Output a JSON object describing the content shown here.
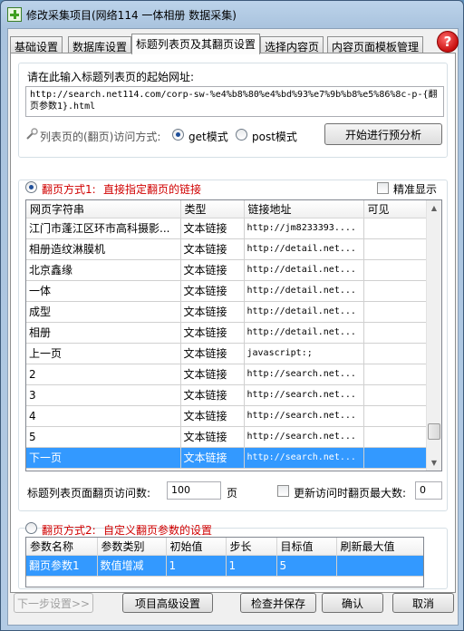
{
  "window": {
    "title": "修改采集项目(网络114 一体相册 数据采集)"
  },
  "tabs": [
    {
      "label": "基础设置",
      "active": false
    },
    {
      "label": "数据库设置",
      "active": false
    },
    {
      "label": "标题列表页及其翻页设置",
      "active": true
    },
    {
      "label": "选择内容页",
      "active": false
    },
    {
      "label": "内容页面模板管理",
      "active": false
    }
  ],
  "help_icon": "help-icon",
  "start_url": {
    "label": "请在此输入标题列表页的起始网址:",
    "value": "http://search.net114.com/corp-sw-%e4%b8%80%e4%bd%93%e7%9b%b8%e5%86%8c-p-{翻页参数1}.html"
  },
  "access_mode": {
    "label": "列表页的(翻页)访问方式:",
    "options": [
      {
        "label": "get模式",
        "selected": true
      },
      {
        "label": "post模式",
        "selected": false
      }
    ],
    "preview_button": "开始进行预分析"
  },
  "mode1": {
    "radio_label": "翻页方式1:",
    "desc": "直接指定翻页的链接",
    "exact_display": "精准显示",
    "columns": [
      "网页字符串",
      "类型",
      "链接地址",
      "可见"
    ],
    "rows": [
      {
        "text": "江门市蓬江区环市高科摄影...",
        "type": "文本链接",
        "url": "http://jm8233393....",
        "visible": "",
        "selected": false
      },
      {
        "text": "相册造纹淋膜机",
        "type": "文本链接",
        "url": "http://detail.net...",
        "visible": "",
        "selected": false
      },
      {
        "text": "北京鑫缘",
        "type": "文本链接",
        "url": "http://detail.net...",
        "visible": "",
        "selected": false
      },
      {
        "text": "一体",
        "type": "文本链接",
        "url": "http://detail.net...",
        "visible": "",
        "selected": false
      },
      {
        "text": "成型",
        "type": "文本链接",
        "url": "http://detail.net...",
        "visible": "",
        "selected": false
      },
      {
        "text": "相册",
        "type": "文本链接",
        "url": "http://detail.net...",
        "visible": "",
        "selected": false
      },
      {
        "text": "上一页",
        "type": "文本链接",
        "url": "javascript:;",
        "visible": "",
        "selected": false
      },
      {
        "text": "2",
        "type": "文本链接",
        "url": "http://search.net...",
        "visible": "",
        "selected": false
      },
      {
        "text": "3",
        "type": "文本链接",
        "url": "http://search.net...",
        "visible": "",
        "selected": false
      },
      {
        "text": "4",
        "type": "文本链接",
        "url": "http://search.net...",
        "visible": "",
        "selected": false
      },
      {
        "text": "5",
        "type": "文本链接",
        "url": "http://search.net...",
        "visible": "",
        "selected": false
      },
      {
        "text": "下一页",
        "type": "文本链接",
        "url": "http://search.net...",
        "visible": "",
        "selected": true
      }
    ],
    "scroll_position": 0.93,
    "max_pages_label": "标题列表页面翻页访问数:",
    "max_pages_value": "100",
    "max_pages_unit": "页",
    "refresh_label": "更新访问时翻页最大数:",
    "refresh_value": "0"
  },
  "mode2": {
    "radio_label": "翻页方式2:",
    "desc": "自定义翻页参数的设置",
    "columns": [
      "参数名称",
      "参数类别",
      "初始值",
      "步长",
      "目标值",
      "刷新最大值"
    ],
    "rows": [
      {
        "name": "翻页参数1",
        "category": "数值增减",
        "initial": "1",
        "step": "1",
        "target": "5",
        "refresh_max": ""
      }
    ]
  },
  "footer": {
    "prev_button": "下一步设置>>",
    "advanced_button": "项目高级设置",
    "check_save_button": "检查并保存",
    "ok_button": "确认",
    "cancel_button": "取消"
  }
}
